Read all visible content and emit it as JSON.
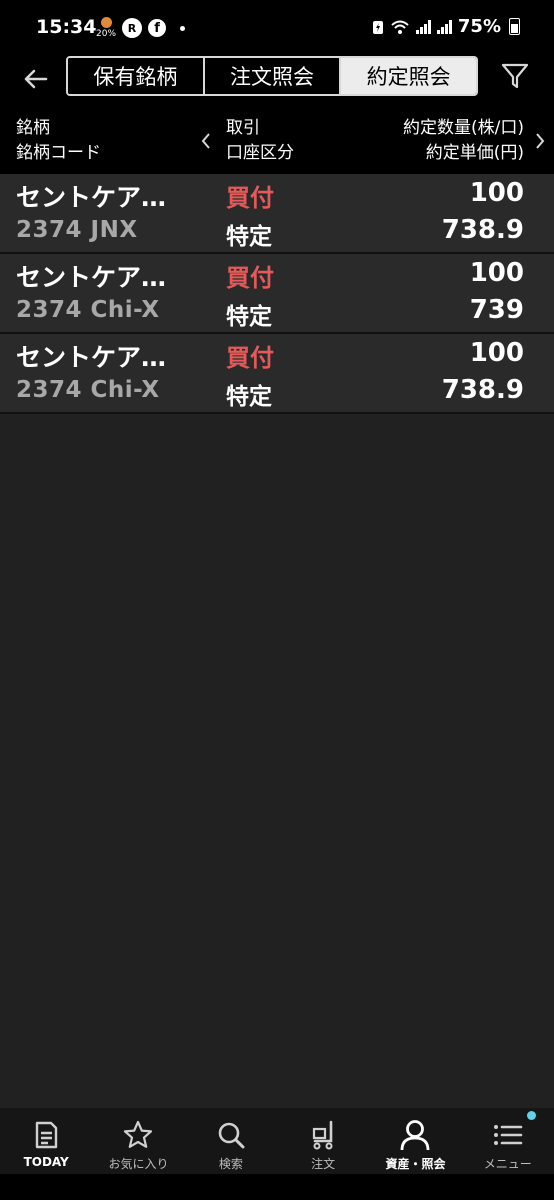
{
  "status_bar": {
    "time": "15:34",
    "weather_pct": "20%",
    "rakuten_glyph": "R",
    "facebook_glyph": "f",
    "battery_pct": "75%"
  },
  "header": {
    "tabs": [
      {
        "label": "保有銘柄",
        "active": false
      },
      {
        "label": "注文照会",
        "active": false
      },
      {
        "label": "約定照会",
        "active": true
      }
    ]
  },
  "columns": {
    "name_line1": "銘柄",
    "name_line2": "銘柄コード",
    "trade_line1": "取引",
    "trade_line2": "口座区分",
    "qty_line1": "約定数量(株/口)",
    "qty_line2": "約定単価(円)"
  },
  "rows": [
    {
      "name": "セントケア…",
      "code": "2374  JNX",
      "side": "買付",
      "account": "特定",
      "qty": "100",
      "price": "738.9"
    },
    {
      "name": "セントケア…",
      "code": "2374  Chi-X",
      "side": "買付",
      "account": "特定",
      "qty": "100",
      "price": "739"
    },
    {
      "name": "セントケア…",
      "code": "2374  Chi-X",
      "side": "買付",
      "account": "特定",
      "qty": "100",
      "price": "738.9"
    }
  ],
  "bottom_nav": [
    {
      "label": "TODAY",
      "icon": "newspaper-icon"
    },
    {
      "label": "お気に入り",
      "icon": "star-icon"
    },
    {
      "label": "検索",
      "icon": "search-icon"
    },
    {
      "label": "注文",
      "icon": "cart-icon"
    },
    {
      "label": "資産・照会",
      "icon": "person-icon",
      "active": true
    },
    {
      "label": "メニュー",
      "icon": "menu-icon"
    }
  ],
  "colors": {
    "buy_red": "#e45a5a",
    "background": "#212121",
    "row_background": "#2a2a2a",
    "badge": "#5fd4e8"
  }
}
